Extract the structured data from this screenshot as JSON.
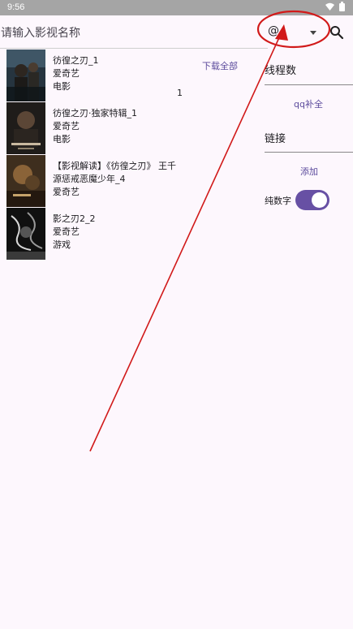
{
  "status_bar": {
    "time": "9:56",
    "wifi_icon": "wifi-icon",
    "battery_icon": "battery-icon"
  },
  "search": {
    "placeholder": "请输入影视名称"
  },
  "source_select": {
    "value": "@"
  },
  "results": [
    {
      "title": "彷徨之刃_1",
      "source": "爱奇艺",
      "type": "电影"
    },
    {
      "title": "彷徨之刃·独家特辑_1",
      "source": "爱奇艺",
      "type": "电影"
    },
    {
      "title": "【影视解读】《彷徨之刃》 王千源惩戒恶魔少年_4",
      "source": "爱奇艺",
      "type": ""
    },
    {
      "title": "影之刃2_2",
      "source": "爱奇艺",
      "type": "游戏"
    }
  ],
  "download_all": "下载全部",
  "count": "1",
  "panel": {
    "threads_label": "线程数",
    "qq_fill": "qq补全",
    "link_label": "链接",
    "add": "添加",
    "digits_only": "纯数字",
    "digits_only_on": true
  },
  "colors": {
    "accent": "#6750a4",
    "annotation": "#d11a1a"
  }
}
